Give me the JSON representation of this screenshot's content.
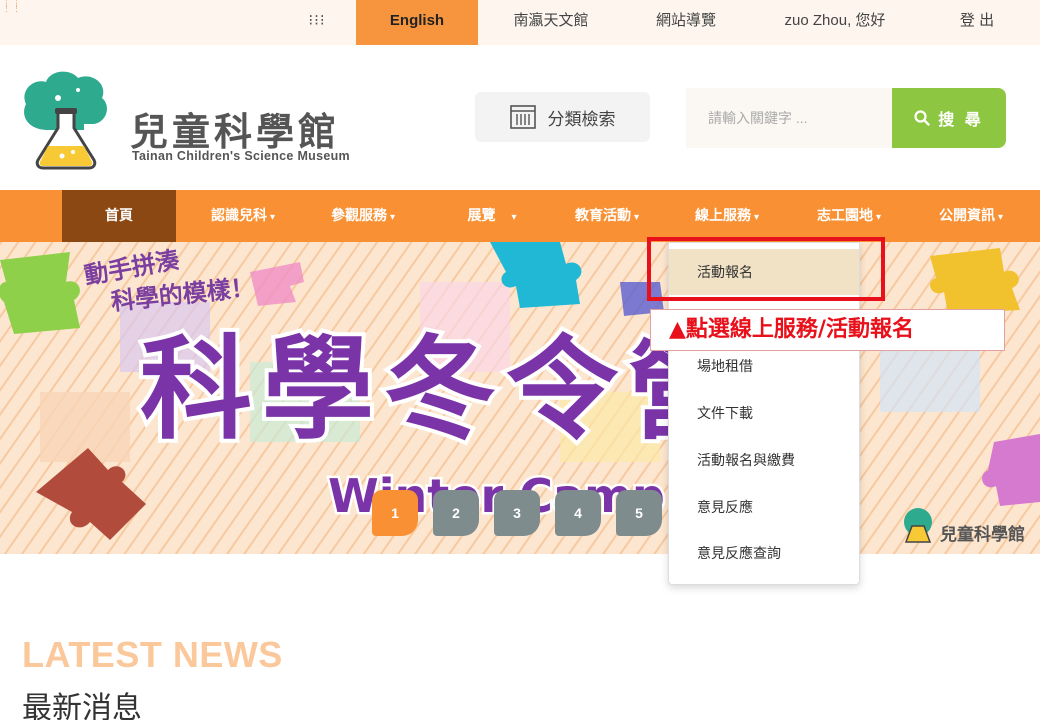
{
  "topbar": {
    "grid_icon": "grid-icon",
    "english": "English",
    "astronomy": "南瀛天文館",
    "sitemap": "網站導覽",
    "user_greeting": "zuo Zhou, 您好",
    "logout": "登 出"
  },
  "header": {
    "logo_title": "兒童科學館",
    "logo_subtitle": "Tainan Children's Science Museum",
    "category_search": "分類檢索",
    "search_placeholder": "請輸入關鍵字 ...",
    "search_button": "搜 尋"
  },
  "nav": {
    "items": [
      {
        "label": "首頁",
        "has_caret": false
      },
      {
        "label": "認識兒科",
        "has_caret": true
      },
      {
        "label": "參觀服務",
        "has_caret": true
      },
      {
        "label": "展覽",
        "has_caret": true
      },
      {
        "label": "教育活動",
        "has_caret": true
      },
      {
        "label": "線上服務",
        "has_caret": true
      },
      {
        "label": "志工園地",
        "has_caret": true
      },
      {
        "label": "公開資訊",
        "has_caret": true
      }
    ]
  },
  "banner": {
    "slogan_line1": "動手拼湊",
    "slogan_line2": "科學的模樣！",
    "big_title": "科學冬令營",
    "subtitle": "Winter Camp 2022",
    "corner_logo": "兒童科學館",
    "corner_logo_sub": "Tainan Children's Science Museum",
    "slides": [
      "1",
      "2",
      "3",
      "4",
      "5"
    ],
    "active_slide": "1"
  },
  "dropdown": {
    "items": [
      "活動報名",
      "場地租借",
      "文件下載",
      "活動報名與繳費",
      "意見反應",
      "意見反應查詢"
    ],
    "active": "活動報名"
  },
  "annotation": {
    "callout": "▲點選線上服務/活動報名"
  },
  "news": {
    "title": "LATEST NEWS",
    "subtitle": "最新消息"
  },
  "colors": {
    "brand_orange": "#f99134",
    "nav_active": "#8b4813",
    "search_green": "#8dc641",
    "annotation_red": "#e8101a",
    "dropdown_active": "#f1e2c6"
  }
}
